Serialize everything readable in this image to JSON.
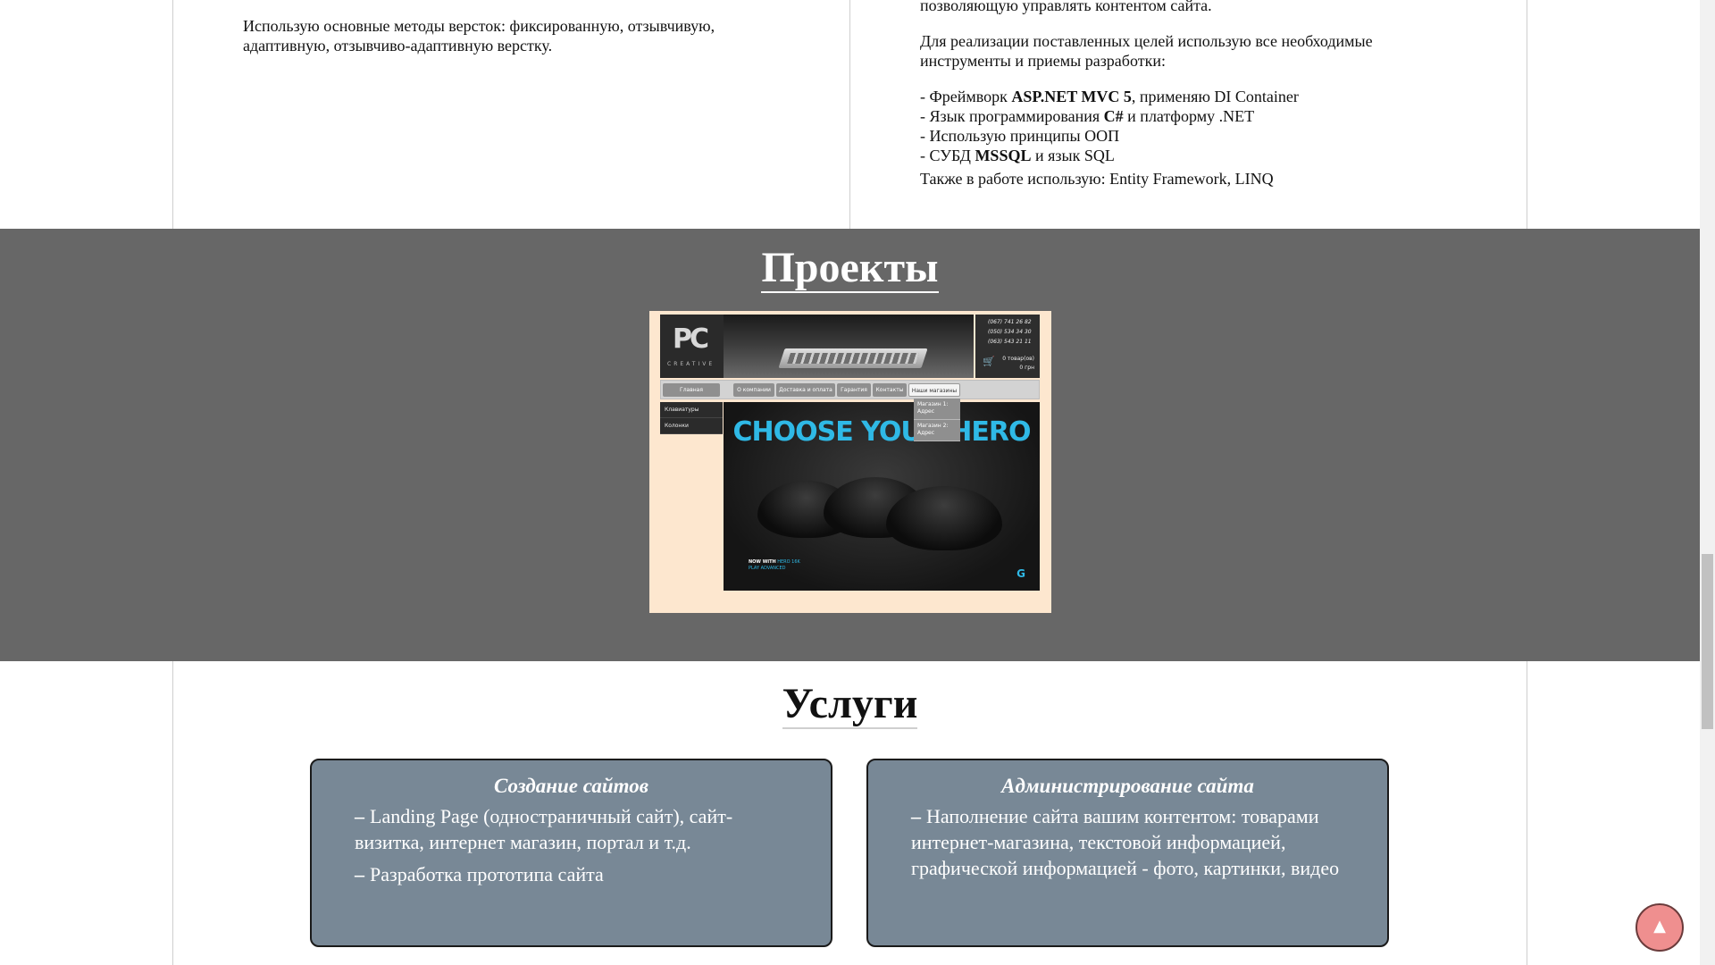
{
  "skills": {
    "layout_text": "Использую основные методы версток: фиксированную, отзывчивую, адаптивную, отзывчиво-адаптивную верстку."
  },
  "backend": {
    "top_cut": "позволяющую управлять контентом сайта.",
    "intro": "Для реализации поставленных целей использую все необходимые инструменты и приемы разработки:",
    "list": [
      {
        "prefix": "- Фреймворк ",
        "bold": "ASP.NET MVC 5",
        "suffix": ", применяю DI Container"
      },
      {
        "prefix": "- Язык программирования ",
        "bold": "C#",
        "suffix": " и платформу .NET"
      },
      {
        "prefix": "- Использую принципы ООП",
        "bold": "",
        "suffix": ""
      },
      {
        "prefix": "- СУБД ",
        "bold": "MSSQL",
        "suffix": " и язык SQL"
      }
    ],
    "also": "Также в работе использую: Entity Framework, LINQ"
  },
  "projects": {
    "title": "Проекты",
    "thumb": {
      "logo_mark": "PC",
      "logo_sub": "CREATIVE",
      "phones": [
        "(067) 741 26 82",
        "(050) 534 34 30",
        "(063) 543 21 11"
      ],
      "cart_icon": "cart-icon",
      "cart_count": "0 товар(ов)",
      "cart_sum": "0 грн",
      "menu": [
        "Главная",
        "О компании",
        "Доставка и оплата",
        "Гарантия",
        "Контакты",
        "Наши магазины"
      ],
      "dropdown": [
        "Магазин 1: Адрес",
        "Магазин 2: Адрес"
      ],
      "sidebar": [
        "Клавиатуры",
        "Колонки"
      ],
      "banner_title": "CHOOSE YOUR HERO",
      "banner_now": "NOW WITH",
      "banner_sensor": "HERO 16K",
      "banner_series": "PLAY ADVANCED",
      "banner_logo": "G"
    }
  },
  "services": {
    "title": "Услуги",
    "cards": [
      {
        "title": "Создание сайтов",
        "items": [
          "Landing Page (одностраничный сайт), сайт-визитка, интернет магазин, портал и т.д.",
          "Разработка прототипа сайта"
        ]
      },
      {
        "title": "Администрирование сайта",
        "items": [
          "Наполнение сайта вашим контентом: товарами интернет-магазина, текстовой информацией, графической информацией - фото, картинки, видео"
        ]
      }
    ],
    "dash": "–"
  },
  "back_to_top": {
    "icon": "arrow-up-icon",
    "glyph": "▲"
  },
  "colors": {
    "projects_bg": "#676767",
    "card_bg": "#788896",
    "back_to_top_bg": "#ef8f8f",
    "banner_accent": "#2fb9e6"
  }
}
